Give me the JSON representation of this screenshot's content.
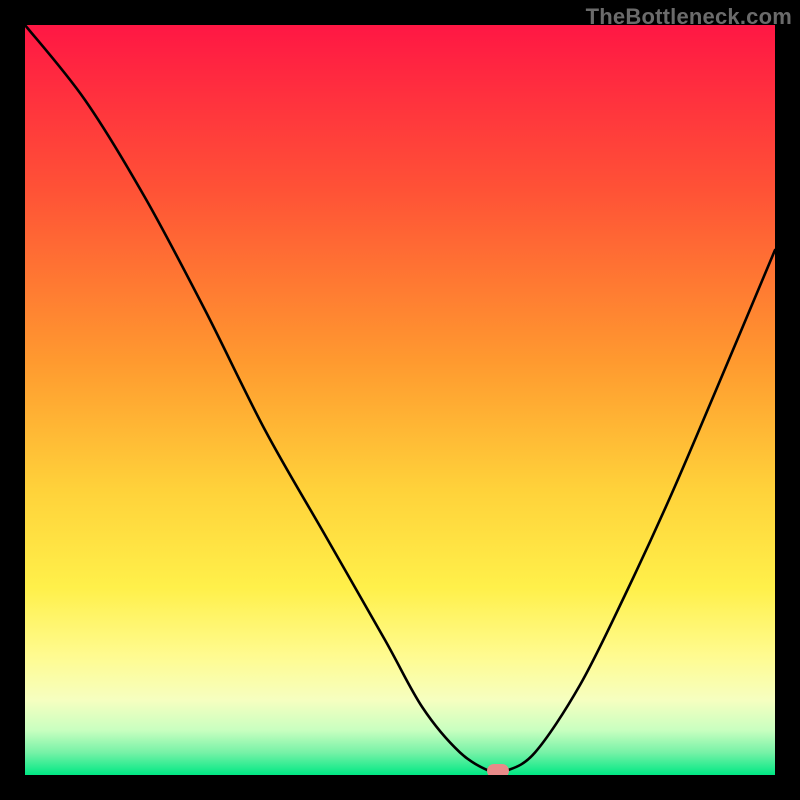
{
  "watermark": "TheBottleneck.com",
  "chart_data": {
    "type": "line",
    "title": "",
    "xlabel": "",
    "ylabel": "",
    "xlim": [
      0,
      100
    ],
    "ylim": [
      0,
      100
    ],
    "grid": false,
    "series": [
      {
        "name": "bottleneck-curve",
        "x": [
          0,
          8,
          16,
          24,
          32,
          40,
          48,
          53,
          58,
          62,
          64,
          68,
          74,
          80,
          86,
          92,
          100
        ],
        "values": [
          103,
          90,
          77,
          62,
          46,
          32,
          18,
          9,
          3,
          0.5,
          0.5,
          3,
          12,
          24,
          37,
          51,
          70
        ]
      }
    ],
    "marker": {
      "x": 63,
      "y": 0.6,
      "color": "#e88a89"
    },
    "gradient_stops": [
      {
        "pos": 0.0,
        "color": "#ff1744"
      },
      {
        "pos": 0.22,
        "color": "#ff5236"
      },
      {
        "pos": 0.45,
        "color": "#ff9a2f"
      },
      {
        "pos": 0.62,
        "color": "#ffd23a"
      },
      {
        "pos": 0.75,
        "color": "#fff04a"
      },
      {
        "pos": 0.84,
        "color": "#fffb8f"
      },
      {
        "pos": 0.9,
        "color": "#f6ffc0"
      },
      {
        "pos": 0.94,
        "color": "#c9ffc0"
      },
      {
        "pos": 0.97,
        "color": "#77f2a7"
      },
      {
        "pos": 1.0,
        "color": "#00e884"
      }
    ]
  }
}
